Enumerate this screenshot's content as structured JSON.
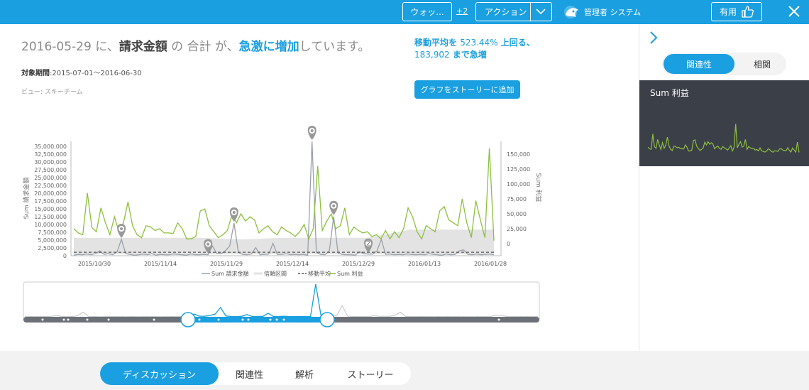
{
  "topbar": {
    "watch_label": "ウォッ...",
    "plus_label": "+2",
    "action_label": "アクション",
    "admin_label": "管理者 システム",
    "useful_label": "有用"
  },
  "headline": {
    "date": "2016-05-29",
    "p1": " に、",
    "measure": "請求金額",
    "p2": " の 合計 が、",
    "trend": "急激に増加",
    "p3": "しています。"
  },
  "period": {
    "label": "対象期間",
    "value": ":2015-07-01～2016-06-30"
  },
  "view_label": "ビュー: スキーチーム",
  "insight": {
    "line1_a": "移動平均を ",
    "line1_pct": "523.44%",
    "line1_b": " 上回る、",
    "line2_num": "183,902",
    "line2_b": " まで急増"
  },
  "add_story_label": "グラフをストーリーに追加",
  "right_panel": {
    "tabs": [
      "関連性",
      "相関"
    ],
    "mini_title": "Sum 利益"
  },
  "bottom_tabs": [
    "ディスカッション",
    "関連性",
    "解析",
    "ストーリー"
  ],
  "colors": {
    "accent": "#1a9fe0",
    "green": "#8dbf3f",
    "gray_line": "#9aa0aa",
    "band": "#e3e3e3",
    "dark": "#3b3f48"
  },
  "chart_data": {
    "type": "line",
    "ylabel": "Sum 請求金額",
    "y2label": "Sum 利益",
    "ylim": [
      0,
      35000000
    ],
    "y2lim": [
      -10000,
      165000
    ],
    "yticks": [
      "35,000,000",
      "32,500,000",
      "30,000,000",
      "27,500,000",
      "25,000,000",
      "22,500,000",
      "20,000,000",
      "17,500,000",
      "15,000,000",
      "12,500,000",
      "10,000,000",
      "7,500,000",
      "5,000,000",
      "2,500,000",
      "0"
    ],
    "y2ticks": [
      "150,000",
      "125,000",
      "100,000",
      "75,000",
      "50,000",
      "25,000",
      "0"
    ],
    "xticks": [
      "2015/10/30",
      "2015/11/14",
      "2015/11/29",
      "2015/12/14",
      "2015/12/29",
      "2016/01/13",
      "2016/01/28"
    ],
    "legend": [
      "Sum 請求金額",
      "信頼区間",
      "移動平均",
      "Sum 利益"
    ],
    "legend_placement": "bottom",
    "series": [
      {
        "name": "Sum 請求金額",
        "values": [
          200000,
          400000,
          300000,
          500000,
          300000,
          600000,
          1500000,
          400000,
          600000,
          300000,
          1200000,
          5000000,
          600000,
          400000,
          200000,
          300000,
          500000,
          300000,
          600000,
          200000,
          400000,
          300000,
          300000,
          500000,
          400000,
          300000,
          200000,
          500000,
          300000,
          300000,
          400000,
          300000,
          3000000,
          700000,
          600000,
          1500000,
          3000000,
          10000000,
          1000000,
          400000,
          300000,
          500000,
          2500000,
          300000,
          400000,
          500000,
          3800000,
          400000,
          400000,
          600000,
          300000,
          400000,
          300000,
          400000,
          200000,
          35000000,
          1000000,
          400000,
          300000,
          1500000,
          12000000,
          800000,
          400000,
          300000,
          300000,
          200000,
          1200000,
          600000,
          500000,
          500000,
          1500000,
          5000000,
          400000,
          500000,
          300000,
          400000,
          300000,
          500000,
          400000,
          300000,
          400000,
          300000,
          600000,
          400000,
          300000,
          200000,
          500000,
          300000,
          400000,
          1500000,
          1800000,
          400000,
          300000,
          500000,
          300000,
          400000,
          500000,
          300000
        ]
      },
      {
        "name": "Sum 利益",
        "values": [
          25000,
          18000,
          15000,
          85000,
          27000,
          20000,
          60000,
          35000,
          15000,
          45000,
          20000,
          35000,
          70000,
          30000,
          15000,
          10000,
          30000,
          28000,
          22000,
          25000,
          18000,
          18000,
          17000,
          35000,
          25000,
          8000,
          8000,
          12000,
          55000,
          58000,
          30000,
          20000,
          10000,
          15000,
          22000,
          48000,
          35000,
          50000,
          38000,
          45000,
          40000,
          18000,
          25000,
          30000,
          20000,
          15000,
          28000,
          22000,
          18000,
          12000,
          20000,
          32000,
          8000,
          25000,
          130000,
          22000,
          38000,
          50000,
          25000,
          30000,
          60000,
          15000,
          28000,
          22000,
          18000,
          20000,
          12000,
          15000,
          8000,
          22000,
          8000,
          20000,
          10000,
          25000,
          60000,
          45000,
          20000,
          8000,
          30000,
          25000,
          20000,
          55000,
          62000,
          40000,
          35000,
          30000,
          75000,
          35000,
          10000,
          72000,
          40000,
          10000,
          160000,
          5000
        ]
      },
      {
        "name": "移動平均",
        "values": [
          1500000,
          1500000,
          1500000,
          1500000,
          1500000,
          1500000,
          1500000,
          1500000,
          1500000,
          1500000,
          1500000
        ]
      }
    ],
    "markers": [
      "",
      "",
      "",
      "",
      "",
      "2"
    ]
  }
}
